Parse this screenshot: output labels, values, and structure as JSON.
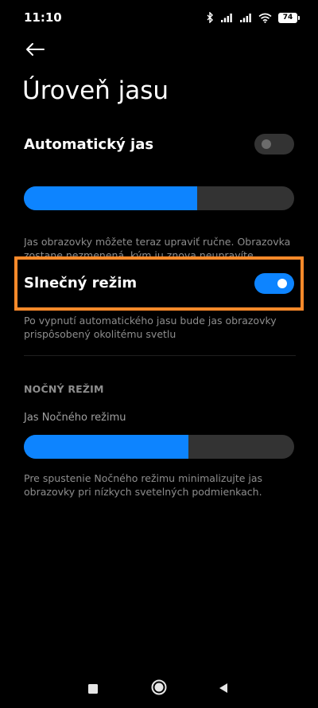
{
  "status_bar": {
    "time": "11:10",
    "battery": "74",
    "icons": [
      "bluetooth-icon",
      "signal-icon",
      "signal-icon",
      "wifi-icon",
      "battery-icon"
    ]
  },
  "header": {
    "back_icon": "arrow-left-icon",
    "title": "Úroveň jasu"
  },
  "auto_brightness": {
    "label": "Automatický jas",
    "enabled": false
  },
  "brightness_slider": {
    "level_percent": 64
  },
  "brightness_description": "Jas obrazovky môžete teraz upraviť ručne. Obrazovka zostane nezmenená, kým ju znova neupravíte",
  "sunlight_mode": {
    "label": "Slnečný režim",
    "enabled": true,
    "description": "Po vypnutí automatického jasu bude jas obrazovky prispôsobený okolitému svetlu"
  },
  "night_mode": {
    "section_title": "NOČNÝ REŽIM",
    "slider_label": "Jas Nočného režimu",
    "level_percent": 61,
    "description": "Pre spustenie Nočného režimu minimalizujte jas obrazovky pri nízkych svetelných podmienkach."
  },
  "colors": {
    "accent": "#0d84ff",
    "highlight": "#ff8a2a",
    "background": "#000000"
  },
  "nav_bar": {
    "icons": [
      "square-icon",
      "circle-icon",
      "triangle-back-icon"
    ]
  }
}
